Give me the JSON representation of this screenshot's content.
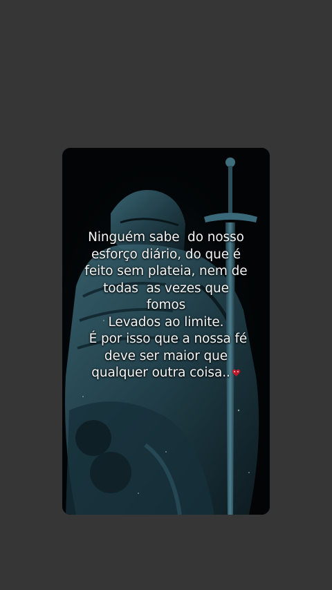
{
  "post": {
    "quote_lines": [
      "Ninguém sabe  do nosso",
      "esforço diário, do que é",
      "feito sem plateia, nem de",
      "todas  as vezes que",
      "fomos",
      "Levados ao limite.",
      " É por isso que a nossa fé",
      "deve ser maior que",
      "qualquer outra coisa.."
    ],
    "emoji": "heart-icon",
    "background": "knight-with-sword-image"
  },
  "colors": {
    "page_background": "#363636",
    "card_background": "#020405",
    "armor_tint": "#2f5866",
    "text": "#f4f6f6",
    "emoji": "#c0182a"
  }
}
